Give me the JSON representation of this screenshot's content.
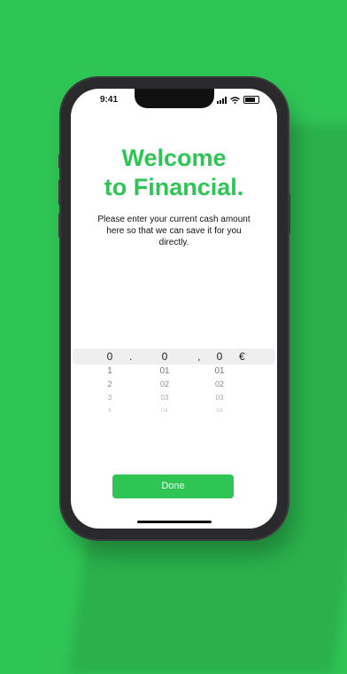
{
  "status_bar": {
    "time": "9:41"
  },
  "welcome": {
    "title_line1": "Welcome",
    "title_line2": "to Financial.",
    "subtitle": "Please enter your current cash amount here so that we can save it for you directly."
  },
  "picker": {
    "columns": [
      {
        "selected": "0",
        "below": [
          "1",
          "2",
          "3",
          "4"
        ]
      },
      {
        "selected": "0",
        "below": [
          "01",
          "02",
          "03",
          "04"
        ]
      },
      {
        "selected": "0",
        "below": [
          "01",
          "02",
          "03",
          "04"
        ]
      }
    ],
    "separator1": ".",
    "separator2": ",",
    "currency": "€"
  },
  "done_button": {
    "label": "Done"
  },
  "colors": {
    "accent": "#2fc555",
    "background": "#2fc555"
  }
}
